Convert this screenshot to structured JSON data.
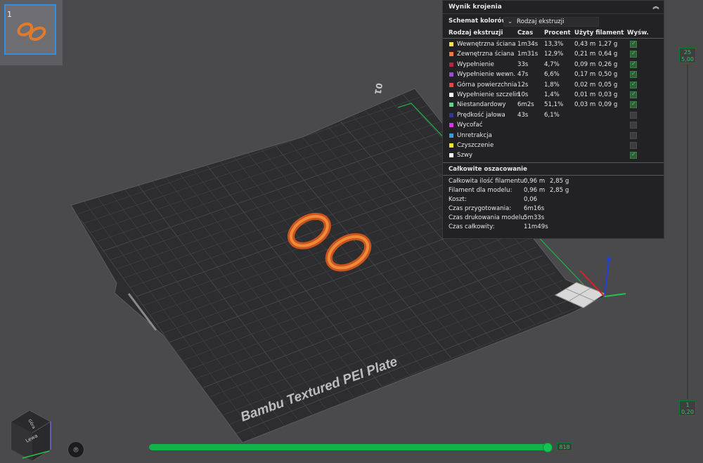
{
  "plate": {
    "number": "1",
    "plate_label": "Bambu Textured PEI Plate",
    "front_mark": "01"
  },
  "results": {
    "title": "Wynik krojenia",
    "scheme_label": "Schemat kolorów",
    "scheme_value": "Rodzaj ekstruzji",
    "headers": {
      "type": "Rodzaj ekstruzji",
      "time": "Czas",
      "percent": "Procent",
      "used": "Użyty filament",
      "show": "Wyśw."
    },
    "rows": [
      {
        "name": "Wewnętrzna ściana",
        "color": "#f5e14b",
        "time": "1m34s",
        "percent": "13,3%",
        "m": "0,43 m",
        "g": "1,27 g",
        "shown": true
      },
      {
        "name": "Zewnętrzna ściana",
        "color": "#f07a3c",
        "time": "1m31s",
        "percent": "12,9%",
        "m": "0,21 m",
        "g": "0,64 g",
        "shown": true
      },
      {
        "name": "Wypełnienie",
        "color": "#b5253b",
        "time": "33s",
        "percent": "4,7%",
        "m": "0,09 m",
        "g": "0,26 g",
        "shown": true
      },
      {
        "name": "Wypełnienie wewn.",
        "color": "#9b4fc6",
        "time": "47s",
        "percent": "6,6%",
        "m": "0,17 m",
        "g": "0,50 g",
        "shown": true
      },
      {
        "name": "Górna powierzchnia",
        "color": "#e8463e",
        "time": "12s",
        "percent": "1,8%",
        "m": "0,02 m",
        "g": "0,05 g",
        "shown": true
      },
      {
        "name": "Wypełnienie szczelin",
        "color": "#ffffff",
        "time": "10s",
        "percent": "1,4%",
        "m": "0,01 m",
        "g": "0,03 g",
        "shown": true
      },
      {
        "name": "Niestandardowy",
        "color": "#5fd18c",
        "time": "6m2s",
        "percent": "51,1%",
        "m": "0,03 m",
        "g": "0,09 g",
        "shown": true
      },
      {
        "name": "Prędkość jałowa",
        "color": "#2e3a8f",
        "time": "43s",
        "percent": "6,1%",
        "m": "",
        "g": "",
        "shown": false
      },
      {
        "name": "Wycofać",
        "color": "#d63ad6",
        "time": "",
        "percent": "",
        "m": "",
        "g": "",
        "shown": false
      },
      {
        "name": "Unretrakcja",
        "color": "#3a9be0",
        "time": "",
        "percent": "",
        "m": "",
        "g": "",
        "shown": false
      },
      {
        "name": "Czyszczenie",
        "color": "#f5e62a",
        "time": "",
        "percent": "",
        "m": "",
        "g": "",
        "shown": false
      },
      {
        "name": "Szwy",
        "color": "#ffffff",
        "time": "",
        "percent": "",
        "m": "",
        "g": "",
        "shown": true
      }
    ],
    "estimate_title": "Całkowite oszacowanie",
    "estimates": [
      {
        "label": "Całkowita ilość filamentu:",
        "v1": "0,96 m",
        "v2": "2,85 g"
      },
      {
        "label": "Filament dla modelu:",
        "v1": "0,96 m",
        "v2": "2,85 g"
      },
      {
        "label": "Koszt:",
        "v1": "0,06",
        "v2": ""
      },
      {
        "label": "Czas przygotowania:",
        "v1": "6m16s",
        "v2": ""
      },
      {
        "label": "Czas drukowania modelu:",
        "v1": "5m33s",
        "v2": ""
      },
      {
        "label": "Czas całkowity:",
        "v1": "11m49s",
        "v2": ""
      }
    ]
  },
  "layer_slider": {
    "top_layer": "25",
    "top_height": "5,00",
    "bottom_layer": "1",
    "bottom_height": "0,20"
  },
  "move_slider": {
    "value": "818"
  },
  "view_cube": {
    "face_label": "Lewa",
    "front_label": "Góra"
  },
  "colors": {
    "accent": "#13c452",
    "panel": "#222224",
    "viewport": "#4a4a4d"
  }
}
